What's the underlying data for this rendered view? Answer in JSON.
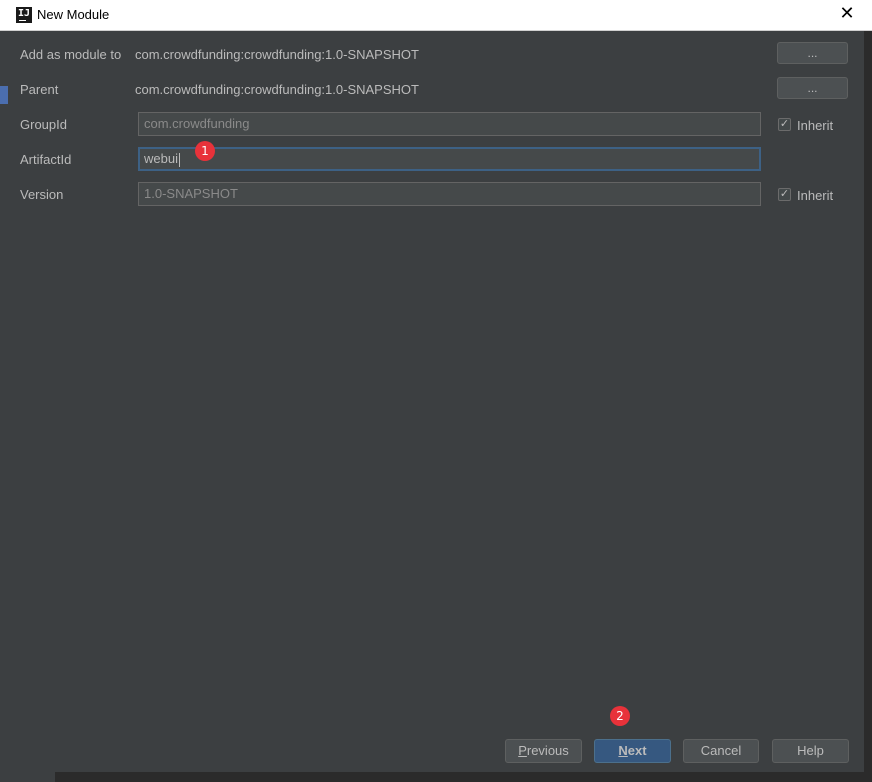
{
  "window": {
    "title": "New Module",
    "close_glyph": "✕",
    "icon_glyph": "IJ"
  },
  "form": {
    "add_as_module": {
      "label": "Add as module to",
      "value": "com.crowdfunding:crowdfunding:1.0-SNAPSHOT",
      "button_label": "..."
    },
    "parent": {
      "label": "Parent",
      "value": "com.crowdfunding:crowdfunding:1.0-SNAPSHOT",
      "button_label": "..."
    },
    "group_id": {
      "label": "GroupId",
      "value": "com.crowdfunding",
      "inherit_label": "Inherit",
      "inherit_checked": true
    },
    "artifact_id": {
      "label": "ArtifactId",
      "value": "webui"
    },
    "version": {
      "label": "Version",
      "value": "1.0-SNAPSHOT",
      "inherit_label": "Inherit",
      "inherit_checked": true
    },
    "check_glyph": "✓"
  },
  "annotations": {
    "marker_1": "1",
    "marker_2": "2",
    "color": "#e8323a"
  },
  "footer": {
    "previous": {
      "mnemonic": "P",
      "rest": "revious"
    },
    "next": {
      "mnemonic": "N",
      "rest": "ext"
    },
    "cancel": "Cancel",
    "help": "Help"
  },
  "colors": {
    "background": "#3c3f41",
    "text": "#bbbbbb",
    "field": "#45494a",
    "focus_border": "#3d6185",
    "primary_button": "#365880"
  }
}
